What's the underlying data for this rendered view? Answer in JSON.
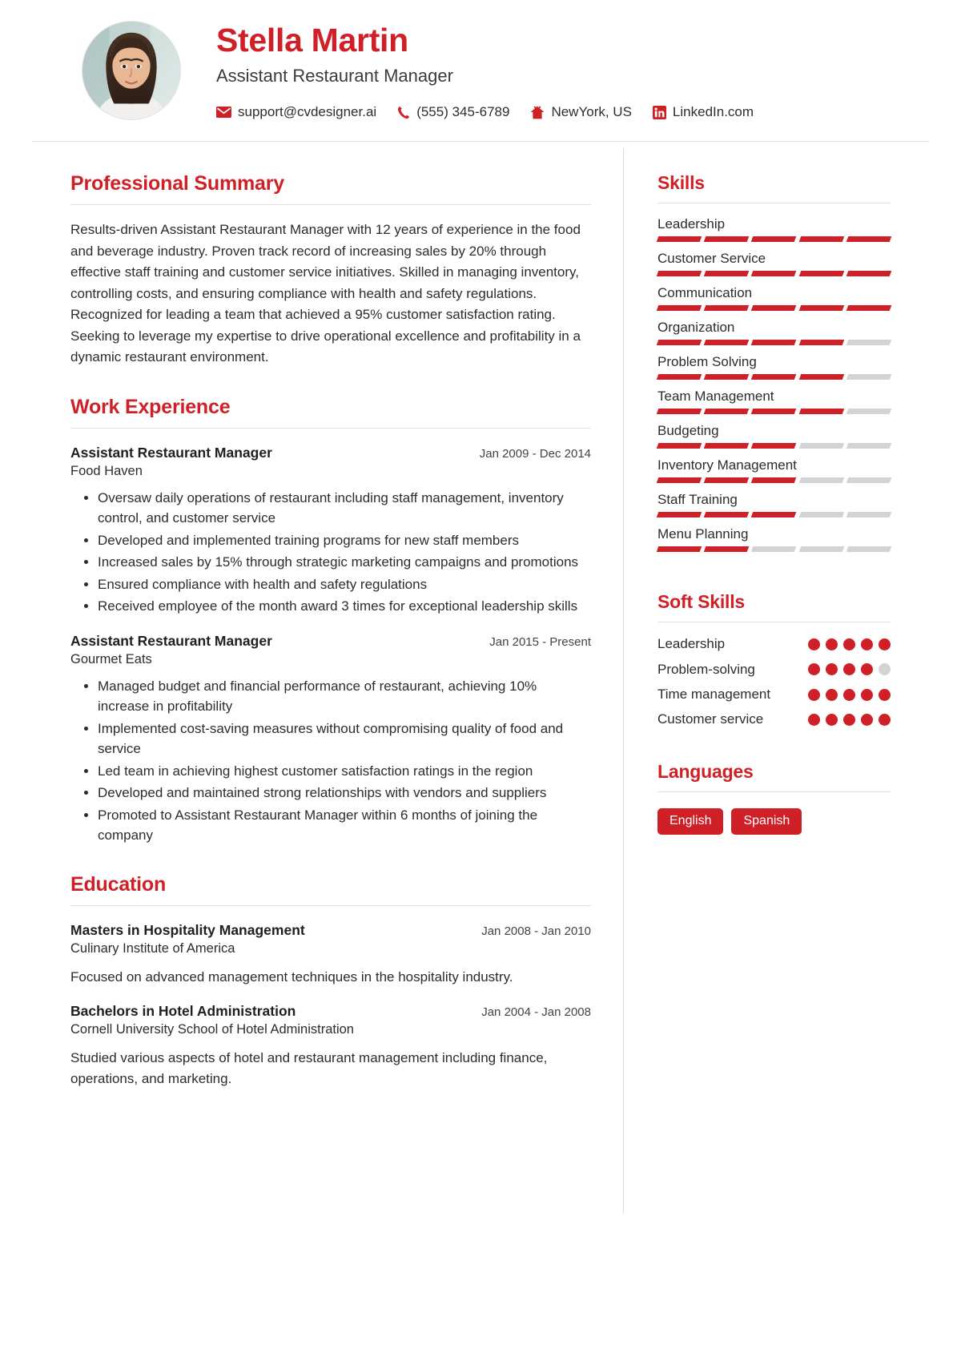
{
  "accent_color": "#cf2027",
  "muted_color": "#d3d3d3",
  "header": {
    "name": "Stella Martin",
    "job_title": "Assistant Restaurant Manager",
    "avatar_alt": "profile-photo",
    "contacts": [
      {
        "icon": "email-icon",
        "text": "support@cvdesigner.ai"
      },
      {
        "icon": "phone-icon",
        "text": "(555) 345-6789"
      },
      {
        "icon": "home-icon",
        "text": "NewYork, US"
      },
      {
        "icon": "linkedin-icon",
        "text": "LinkedIn.com"
      }
    ]
  },
  "main": {
    "summary": {
      "heading": "Professional Summary",
      "text": "Results-driven Assistant Restaurant Manager with 12 years of experience in the food and beverage industry. Proven track record of increasing sales by 20% through effective staff training and customer service initiatives. Skilled in managing inventory, controlling costs, and ensuring compliance with health and safety regulations. Recognized for leading a team that achieved a 95% customer satisfaction rating. Seeking to leverage my expertise to drive operational excellence and profitability in a dynamic restaurant environment."
    },
    "work": {
      "heading": "Work Experience",
      "entries": [
        {
          "title": "Assistant Restaurant Manager",
          "org": "Food Haven",
          "date": "Jan 2009 - Dec 2014",
          "bullets": [
            "Oversaw daily operations of restaurant including staff management, inventory control, and customer service",
            "Developed and implemented training programs for new staff members",
            "Increased sales by 15% through strategic marketing campaigns and promotions",
            "Ensured compliance with health and safety regulations",
            "Received employee of the month award 3 times for exceptional leadership skills"
          ]
        },
        {
          "title": "Assistant Restaurant Manager",
          "org": "Gourmet Eats",
          "date": "Jan 2015 - Present",
          "bullets": [
            "Managed budget and financial performance of restaurant, achieving 10% increase in profitability",
            "Implemented cost-saving measures without compromising quality of food and service",
            "Led team in achieving highest customer satisfaction ratings in the region",
            "Developed and maintained strong relationships with vendors and suppliers",
            "Promoted to Assistant Restaurant Manager within 6 months of joining the company"
          ]
        }
      ]
    },
    "education": {
      "heading": "Education",
      "entries": [
        {
          "title": "Masters in Hospitality Management",
          "org": "Culinary Institute of America",
          "date": "Jan 2008 - Jan 2010",
          "desc": "Focused on advanced management techniques in the hospitality industry."
        },
        {
          "title": "Bachelors in Hotel Administration",
          "org": "Cornell University School of Hotel Administration",
          "date": "Jan 2004 - Jan 2008",
          "desc": "Studied various aspects of hotel and restaurant management including finance, operations, and marketing."
        }
      ]
    }
  },
  "sidebar": {
    "skills": {
      "heading": "Skills",
      "max": 5,
      "items": [
        {
          "name": "Leadership",
          "level": 5
        },
        {
          "name": "Customer Service",
          "level": 5
        },
        {
          "name": "Communication",
          "level": 5
        },
        {
          "name": "Organization",
          "level": 4
        },
        {
          "name": "Problem Solving",
          "level": 4
        },
        {
          "name": "Team Management",
          "level": 4
        },
        {
          "name": "Budgeting",
          "level": 3
        },
        {
          "name": "Inventory Management",
          "level": 3
        },
        {
          "name": "Staff Training",
          "level": 3
        },
        {
          "name": "Menu Planning",
          "level": 2
        }
      ]
    },
    "soft_skills": {
      "heading": "Soft Skills",
      "max": 5,
      "items": [
        {
          "name": "Leadership",
          "level": 5
        },
        {
          "name": "Problem-solving",
          "level": 4
        },
        {
          "name": "Time management",
          "level": 5
        },
        {
          "name": "Customer service",
          "level": 5
        }
      ]
    },
    "languages": {
      "heading": "Languages",
      "items": [
        "English",
        "Spanish"
      ]
    }
  }
}
